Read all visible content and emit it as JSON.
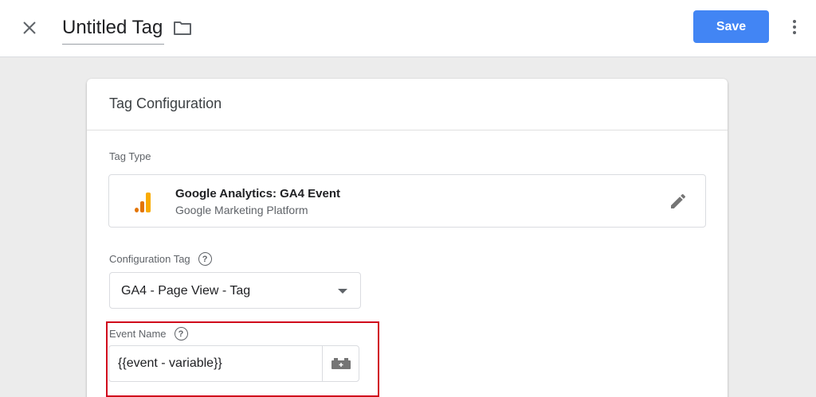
{
  "header": {
    "title": "Untitled Tag",
    "save_label": "Save",
    "icons": {
      "close": "close-icon",
      "folder": "folder-icon",
      "more": "more-vert-icon"
    },
    "colors": {
      "save_button": "#4285f4"
    }
  },
  "card": {
    "title": "Tag Configuration",
    "tag_type": {
      "label": "Tag Type",
      "name": "Google Analytics: GA4 Event",
      "platform": "Google Marketing Platform",
      "icon": "google-analytics-icon"
    },
    "configuration_tag": {
      "label": "Configuration Tag",
      "selected": "GA4 - Page View - Tag"
    },
    "event_name": {
      "label": "Event Name",
      "value": "{{event - variable}}"
    }
  },
  "annotation": {
    "highlight_color": "#d0021b"
  }
}
